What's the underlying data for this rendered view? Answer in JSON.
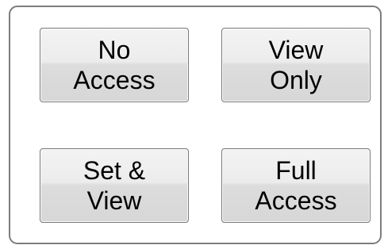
{
  "access_panel": {
    "buttons": [
      {
        "line1": "No",
        "line2": "Access"
      },
      {
        "line1": "View",
        "line2": "Only"
      },
      {
        "line1": "Set &",
        "line2": "View"
      },
      {
        "line1": "Full",
        "line2": "Access"
      }
    ]
  }
}
